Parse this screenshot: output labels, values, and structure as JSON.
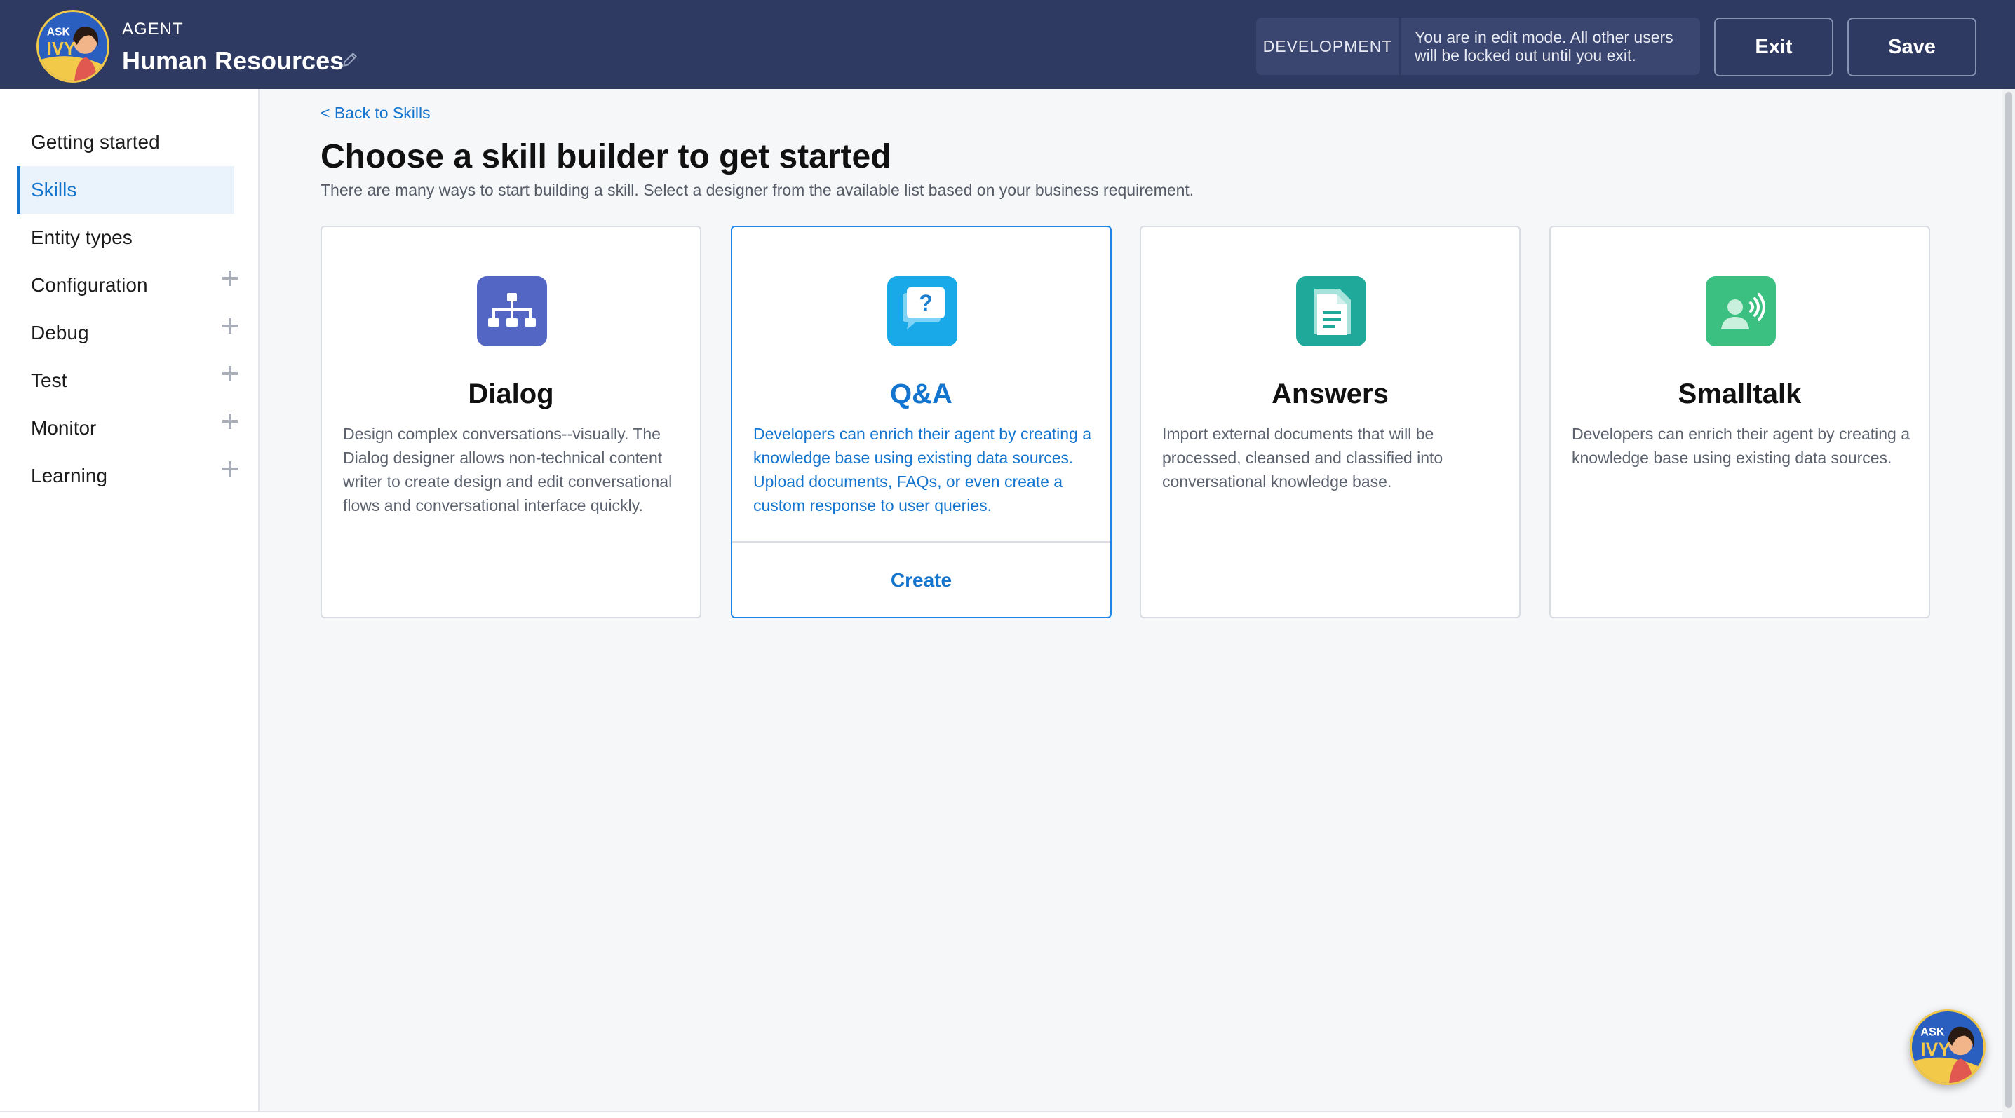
{
  "header": {
    "agent_label": "AGENT",
    "agent_name": "Human Resources",
    "logo_text_top": "ASK",
    "logo_text_bottom": "IVY",
    "environment": "DEVELOPMENT",
    "edit_message": "You are in edit mode. All other users will be locked out until you exit.",
    "exit_label": "Exit",
    "save_label": "Save",
    "brand_color": "#2e3a62"
  },
  "sidebar": {
    "items": [
      {
        "label": "Getting started",
        "expandable": false,
        "active": false
      },
      {
        "label": "Skills",
        "expandable": false,
        "active": true
      },
      {
        "label": "Entity types",
        "expandable": false,
        "active": false
      },
      {
        "label": "Configuration",
        "expandable": true,
        "active": false
      },
      {
        "label": "Debug",
        "expandable": true,
        "active": false
      },
      {
        "label": "Test",
        "expandable": true,
        "active": false
      },
      {
        "label": "Monitor",
        "expandable": true,
        "active": false
      },
      {
        "label": "Learning",
        "expandable": true,
        "active": false
      }
    ]
  },
  "main": {
    "back_link": "< Back to Skills",
    "title": "Choose a skill builder to get started",
    "subtitle": "There are many ways to start building a skill. Select a designer from the available list based on your business requirement.",
    "cards": [
      {
        "title": "Dialog",
        "icon": "org-chart-icon",
        "color": "#5466c4",
        "selected": false,
        "description": "Design complex conversations--visually. The Dialog designer allows non-technical content writer to create design and edit conversational flows and conversational interface quickly."
      },
      {
        "title": "Q&A",
        "icon": "question-chat-icon",
        "color": "#1aa9e8",
        "selected": true,
        "action": "Create",
        "description": "Developers can enrich their agent by creating a knowledge base using existing data sources. Upload documents, FAQs, or even create a custom response to user queries."
      },
      {
        "title": "Answers",
        "icon": "document-icon",
        "color": "#1fa99a",
        "selected": false,
        "description": "Import external documents that will be processed, cleansed and classified into conversational knowledge base."
      },
      {
        "title": "Smalltalk",
        "icon": "speaking-person-icon",
        "color": "#3cc081",
        "selected": false,
        "description": "Developers can enrich their agent by creating a knowledge base using existing data sources."
      }
    ]
  },
  "accent_color": "#1475cf"
}
